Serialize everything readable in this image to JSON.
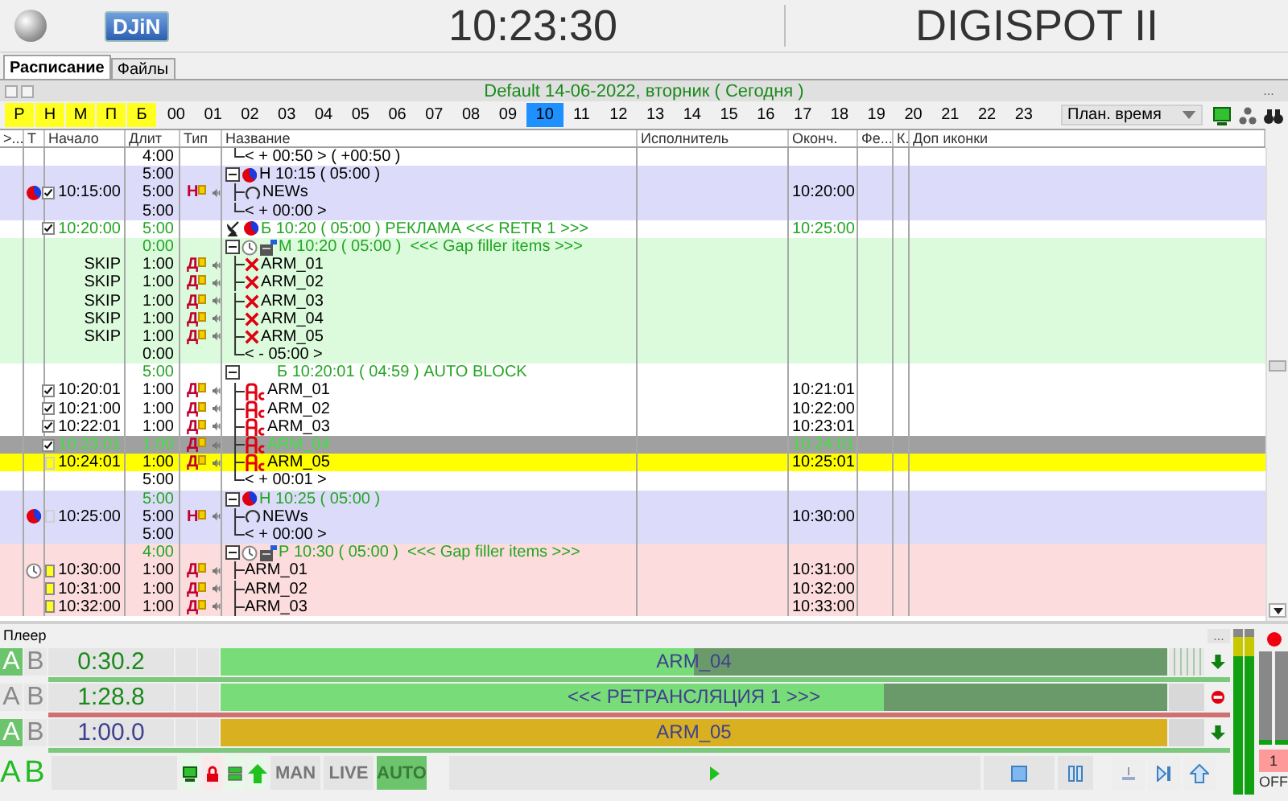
{
  "header": {
    "logo": "DJiN",
    "clock": "10:23:30",
    "product": "DIGISPOT II"
  },
  "tabs": [
    {
      "label": "Расписание",
      "selected": true
    },
    {
      "label": "Файлы",
      "selected": false
    }
  ],
  "schedule": {
    "title": "Default 14-06-2022, вторник ( Сегодня )",
    "more": "...",
    "filters": [
      {
        "label": "Р",
        "on": true
      },
      {
        "label": "Н",
        "on": true
      },
      {
        "label": "М",
        "on": true
      },
      {
        "label": "П",
        "on": true
      },
      {
        "label": "Б",
        "on": true
      }
    ],
    "hours": [
      {
        "label": "00",
        "selected": false
      },
      {
        "label": "01",
        "selected": false
      },
      {
        "label": "02",
        "selected": false
      },
      {
        "label": "03",
        "selected": false
      },
      {
        "label": "04",
        "selected": false
      },
      {
        "label": "05",
        "selected": false
      },
      {
        "label": "06",
        "selected": false
      },
      {
        "label": "07",
        "selected": false
      },
      {
        "label": "08",
        "selected": false
      },
      {
        "label": "09",
        "selected": false
      },
      {
        "label": "10",
        "selected": true
      },
      {
        "label": "11",
        "selected": false
      },
      {
        "label": "12",
        "selected": false
      },
      {
        "label": "13",
        "selected": false
      },
      {
        "label": "14",
        "selected": false
      },
      {
        "label": "15",
        "selected": false
      },
      {
        "label": "16",
        "selected": false
      },
      {
        "label": "17",
        "selected": false
      },
      {
        "label": "18",
        "selected": false
      },
      {
        "label": "19",
        "selected": false
      },
      {
        "label": "20",
        "selected": false
      },
      {
        "label": "21",
        "selected": false
      },
      {
        "label": "22",
        "selected": false
      },
      {
        "label": "23",
        "selected": false
      }
    ],
    "sort": "План. время",
    "columns": [
      ">...",
      "Т",
      "Начало",
      "Длит",
      "Тип",
      "Название",
      "Исполнитель",
      "Оконч.",
      "Фе...",
      "К.",
      "Доп иконки"
    ],
    "rows": [
      {
        "color": "#ffffff",
        "kind": "tail",
        "live": false,
        "duration": "4:00",
        "name": "< + 00:50 > ( +00:50 )"
      },
      {
        "color": "#dcdcfa",
        "kind": "group",
        "live": false,
        "duration": "5:00",
        "icons": [
          {
            "kind": "pie"
          }
        ],
        "name": "Н 10:15 ( 05:00 )",
        "children": [
          {
            "color": "#dcdcfa",
            "kind": "item",
            "live": false,
            "marker": {
              "kind": "pie"
            },
            "checked": true,
            "start": "10:15:00",
            "duration": "5:00",
            "type": "Н",
            "icons": [
              {
                "kind": "news"
              }
            ],
            "name": "NEWs",
            "end": "10:20:00"
          },
          {
            "color": "#dcdcfa",
            "kind": "tail",
            "live": false,
            "duration": "5:00",
            "name": "< + 00:00 >"
          }
        ]
      },
      {
        "color": "#ffffff",
        "kind": "header",
        "live": true,
        "checked": true,
        "start": "10:20:00",
        "duration": "5:00",
        "icons": [
          {
            "kind": "satellite"
          },
          {
            "kind": "pie"
          }
        ],
        "name": "Б 10:20 ( 05:00 ) РЕКЛАМА <<< RETR 1 >>>",
        "end": "10:25:00"
      },
      {
        "color": "#dcfadc",
        "kind": "group",
        "live": true,
        "duration": "0:00",
        "icons": [
          {
            "kind": "clock"
          },
          {
            "kind": "cabinet"
          }
        ],
        "name": "М 10:20 ( 05:00 )  <<< Gap filler items >>>",
        "children": [
          {
            "color": "#dcfadc",
            "kind": "item",
            "live": false,
            "start": "SKIP",
            "duration": "1:00",
            "type": "Д",
            "icons": [
              {
                "kind": "cross"
              }
            ],
            "name": "ARM_01"
          },
          {
            "color": "#dcfadc",
            "kind": "item",
            "live": false,
            "start": "SKIP",
            "duration": "1:00",
            "type": "Д",
            "icons": [
              {
                "kind": "cross"
              }
            ],
            "name": "ARM_02"
          },
          {
            "color": "#dcfadc",
            "kind": "item",
            "live": false,
            "start": "SKIP",
            "duration": "1:00",
            "type": "Д",
            "icons": [
              {
                "kind": "cross"
              }
            ],
            "name": "ARM_03"
          },
          {
            "color": "#dcfadc",
            "kind": "item",
            "live": false,
            "start": "SKIP",
            "duration": "1:00",
            "type": "Д",
            "icons": [
              {
                "kind": "cross"
              }
            ],
            "name": "ARM_04"
          },
          {
            "color": "#dcfadc",
            "kind": "item",
            "live": false,
            "start": "SKIP",
            "duration": "1:00",
            "type": "Д",
            "icons": [
              {
                "kind": "cross"
              }
            ],
            "name": "ARM_05"
          },
          {
            "color": "#dcfadc",
            "kind": "tail",
            "live": false,
            "duration": "0:00",
            "name": "< - 05:00 >"
          }
        ]
      },
      {
        "color": "#ffffff",
        "kind": "group",
        "live": true,
        "duration": "5:00",
        "name": "Б 10:20:01 ( 04:59 ) AUTO BLOCK",
        "children": [
          {
            "color": "#ffffff",
            "kind": "item",
            "live": false,
            "checked": true,
            "start": "10:20:01",
            "duration": "1:00",
            "type": "Д",
            "icons": [
              {
                "kind": "ac"
              }
            ],
            "name": "ARM_01",
            "end": "10:21:01"
          },
          {
            "color": "#ffffff",
            "kind": "item",
            "live": false,
            "checked": true,
            "start": "10:21:00",
            "duration": "1:00",
            "type": "Д",
            "icons": [
              {
                "kind": "ac"
              }
            ],
            "name": "ARM_02",
            "end": "10:22:00"
          },
          {
            "color": "#ffffff",
            "kind": "item",
            "live": false,
            "checked": true,
            "start": "10:22:01",
            "duration": "1:00",
            "type": "Д",
            "icons": [
              {
                "kind": "ac"
              }
            ],
            "name": "ARM_03",
            "end": "10:23:01"
          },
          {
            "color": "#a0a0a0",
            "kind": "item",
            "live": true,
            "checked": true,
            "start": "10:23:01",
            "duration": "1:00",
            "type": "Д",
            "icons": [
              {
                "kind": "ac"
              }
            ],
            "name": "ARM_04",
            "end": "10:24:01"
          },
          {
            "color": "#ffff00",
            "kind": "item",
            "live": false,
            "checked": false,
            "start": "10:24:01",
            "duration": "1:00",
            "type": "Д",
            "icons": [
              {
                "kind": "ac"
              }
            ],
            "name": "ARM_05",
            "end": "10:25:01"
          },
          {
            "color": "#ffffff",
            "kind": "tail",
            "live": false,
            "duration": "5:00",
            "name": "< + 00:01 >"
          }
        ]
      },
      {
        "color": "#dcdcfa",
        "kind": "group",
        "live": true,
        "duration": "5:00",
        "icons": [
          {
            "kind": "pie"
          }
        ],
        "name": "Н 10:25 ( 05:00 )",
        "children": [
          {
            "color": "#dcdcfa",
            "kind": "item",
            "live": false,
            "marker": {
              "kind": "pie"
            },
            "checked": false,
            "start": "10:25:00",
            "duration": "5:00",
            "type": "Н",
            "icons": [
              {
                "kind": "news"
              }
            ],
            "name": "NEWs",
            "end": "10:30:00"
          },
          {
            "color": "#dcdcfa",
            "kind": "tail",
            "live": false,
            "duration": "5:00",
            "name": "< + 00:00 >"
          }
        ]
      },
      {
        "color": "#fcdcdc",
        "kind": "group",
        "live": true,
        "duration": "4:00",
        "icons": [
          {
            "kind": "clock"
          },
          {
            "kind": "cabinet"
          }
        ],
        "name": "Р 10:30 ( 05:00 )  <<< Gap filler items >>>",
        "children": [
          {
            "color": "#fcdcdc",
            "kind": "item",
            "live": false,
            "marker": {
              "kind": "clock"
            },
            "checked": false,
            "pending": true,
            "start": "10:30:00",
            "duration": "1:00",
            "type": "Д",
            "name": "ARM_01",
            "end": "10:31:00"
          },
          {
            "color": "#fcdcdc",
            "kind": "item",
            "live": false,
            "checked": false,
            "pending": true,
            "start": "10:31:00",
            "duration": "1:00",
            "type": "Д",
            "name": "ARM_02",
            "end": "10:32:00"
          },
          {
            "color": "#fcdcdc",
            "kind": "item",
            "live": false,
            "checked": false,
            "pending": true,
            "start": "10:32:00",
            "duration": "1:00",
            "type": "Д",
            "name": "ARM_03",
            "end": "10:33:00"
          }
        ]
      }
    ]
  },
  "player": {
    "label": "Плеер",
    "more": "...",
    "decks": [
      {
        "kind": "playing",
        "a": "A",
        "b": "B",
        "active": true,
        "time": "0:30.2",
        "title": "ARM_04",
        "level": 0.5
      },
      {
        "kind": "live",
        "a": "A",
        "b": "B",
        "active": false,
        "time": "1:28.8",
        "title": "<<< РЕТРАНСЛЯЦИЯ 1 >>>",
        "level": 0.7
      },
      {
        "kind": "next",
        "a": "A",
        "b": "B",
        "active": true,
        "time": "1:00.0",
        "title": "ARM_05",
        "level": 1
      }
    ],
    "ab": {
      "a": "A",
      "b": "B"
    },
    "modes": [
      {
        "label": "MAN",
        "selected": false
      },
      {
        "label": "LIVE",
        "selected": false
      },
      {
        "label": "AUTO",
        "selected": true
      }
    ],
    "meters": [
      {
        "level": 0.95
      },
      {
        "level": 0.95
      }
    ],
    "channel": {
      "number": "1",
      "state": "OFF",
      "levels": [
        {
          "level": 0.05
        },
        {
          "level": 0.05
        }
      ]
    }
  }
}
